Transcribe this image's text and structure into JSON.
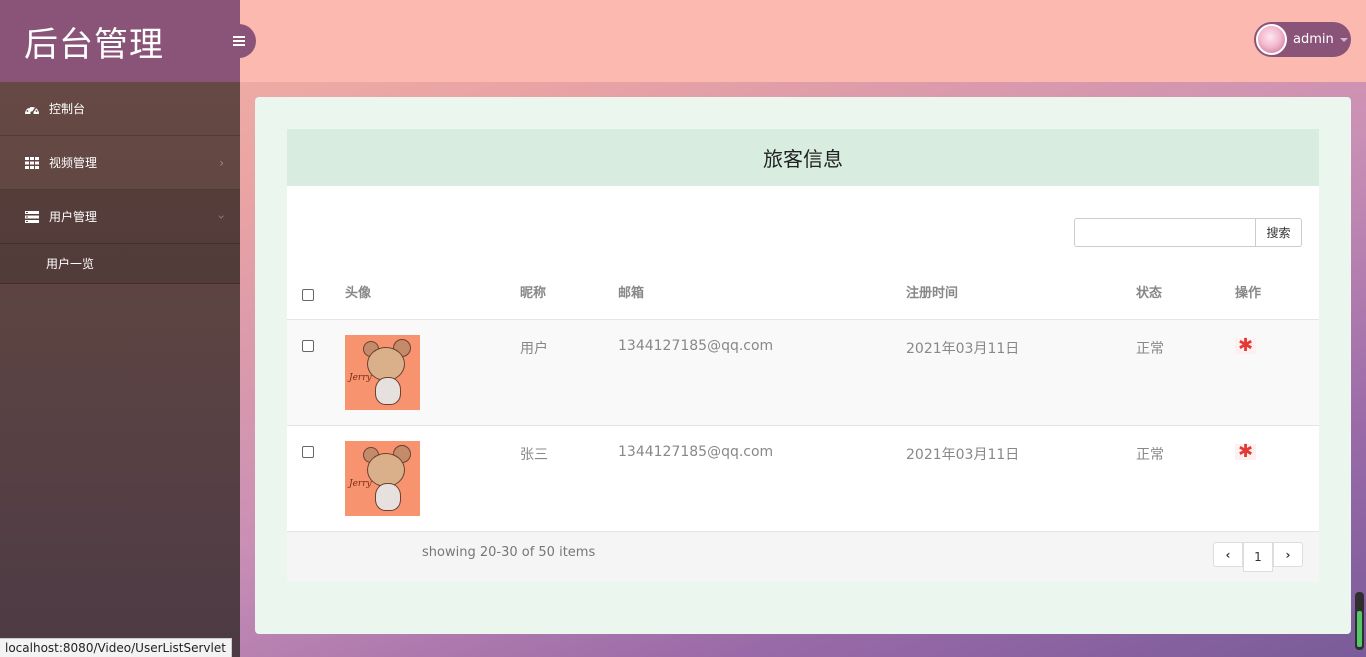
{
  "sidebar": {
    "logo": "后台管理",
    "items": [
      {
        "label": "控制台",
        "icon": "dashboard-icon"
      },
      {
        "label": "视频管理",
        "icon": "grid-icon"
      },
      {
        "label": "用户管理",
        "icon": "list-icon"
      }
    ],
    "subitems": [
      {
        "label": "用户一览"
      }
    ]
  },
  "header": {
    "username": "admin"
  },
  "panel": {
    "title": "旅客信息",
    "search": {
      "placeholder": "",
      "button_label": "搜索"
    }
  },
  "table": {
    "columns": [
      "头像",
      "昵称",
      "邮箱",
      "注册时间",
      "状态",
      "操作"
    ],
    "rows": [
      {
        "nickname": "用户",
        "email": "1344127185@qq.com",
        "registered": "2021年03月11日",
        "status": "正常"
      },
      {
        "nickname": "张三",
        "email": "1344127185@qq.com",
        "registered": "2021年03月11日",
        "status": "正常"
      }
    ]
  },
  "pagination": {
    "summary": "showing 20-30 of 50 items",
    "current_page": "1",
    "prev": "‹",
    "next": "›"
  },
  "browser_status": "localhost:8080/Video/UserListServlet",
  "colors": {
    "sidebar_logo_bg": "#8a5478",
    "header_bg": "#fbb9b0",
    "panel_title_bg": "#d8ece0",
    "delete_icon": "#e53935"
  }
}
